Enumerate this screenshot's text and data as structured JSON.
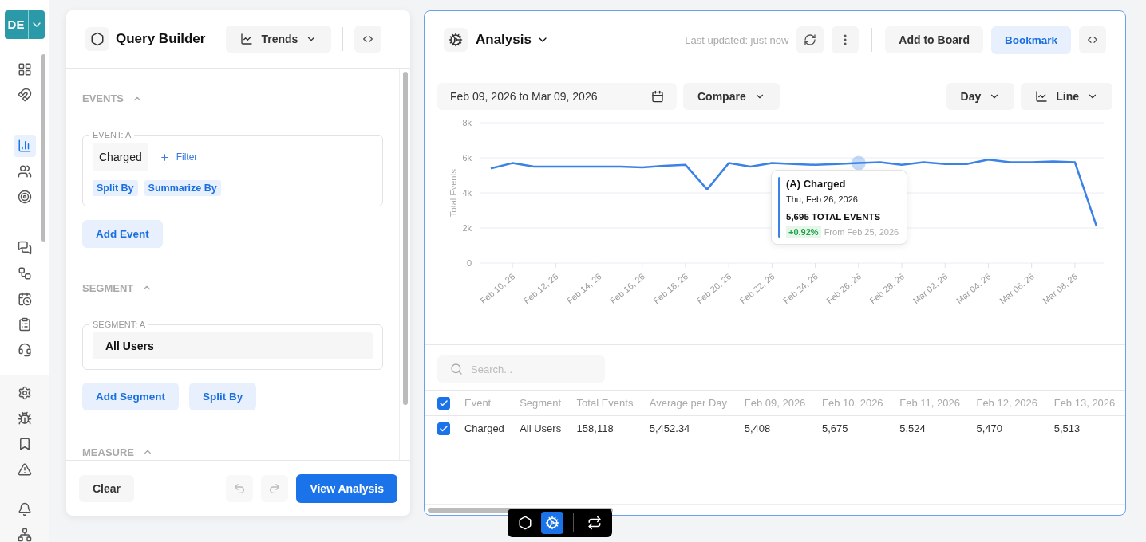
{
  "workspace": {
    "badge": "DE"
  },
  "nav": {
    "items": [
      {
        "selected": false
      },
      {
        "selected": false
      },
      {
        "selected": true
      },
      {
        "selected": false
      },
      {
        "selected": false
      },
      {
        "selected": false
      },
      {
        "selected": false
      },
      {
        "selected": false
      },
      {
        "selected": false
      },
      {
        "selected": false
      }
    ],
    "bottom_items": [
      {
        "selected": false
      },
      {
        "selected": false
      },
      {
        "selected": false
      },
      {
        "selected": false
      },
      {
        "selected": false
      },
      {
        "selected": false
      }
    ]
  },
  "query_builder": {
    "title": "Query Builder",
    "mode": "Trends",
    "events": {
      "heading": "EVENTS",
      "expanded": true,
      "legend": "EVENT: A",
      "event": "Charged",
      "filter": "Filter",
      "chips": [
        "Split By",
        "Summarize By"
      ],
      "add": "Add Event"
    },
    "segment": {
      "heading": "SEGMENT",
      "expanded": true,
      "legend": "SEGMENT: A",
      "value": "All Users",
      "buttons": [
        "Add Segment",
        "Split By"
      ]
    },
    "measure": {
      "heading": "MEASURE",
      "expanded": true
    },
    "footer": {
      "clear": "Clear",
      "undo_disabled": true,
      "redo_disabled": true,
      "submit": "View Analysis"
    }
  },
  "analysis": {
    "title": "Analysis",
    "last_updated": "Last updated: just now",
    "add_to_board": "Add to Board",
    "bookmark": "Bookmark",
    "date_range": "Feb 09, 2026 to Mar 09, 2026",
    "compare": "Compare",
    "interval": "Day",
    "chart_type": "Line",
    "chart": {
      "chart_data": {
        "type": "line",
        "grid": true,
        "ylabel": "Total Events",
        "ylim": [
          0,
          8000
        ],
        "yticks": [
          {
            "value": 0,
            "label": "0"
          },
          {
            "value": 2000,
            "label": "2k"
          },
          {
            "value": 4000,
            "label": "4k"
          },
          {
            "value": 6000,
            "label": "6k"
          },
          {
            "value": 8000,
            "label": "8k"
          }
        ],
        "categories": [
          null,
          "Feb 10, 26",
          null,
          "Feb 12, 26",
          null,
          "Feb 14, 26",
          null,
          "Feb 16, 26",
          null,
          "Feb 18, 26",
          null,
          "Feb 20, 26",
          null,
          "Feb 22, 26",
          null,
          "Feb 24, 26",
          null,
          "Feb 26, 26",
          null,
          "Feb 28, 26",
          null,
          "Mar 02, 26",
          null,
          "Mar 04, 26",
          null,
          "Mar 06, 26",
          null,
          "Mar 08, 26",
          null
        ],
        "series": [
          {
            "name": "(A) Charged",
            "color": "#3b82e8",
            "values": [
              5400,
              5700,
              5500,
              5500,
              5500,
              5500,
              5500,
              5450,
              5550,
              5600,
              4200,
              5700,
              5500,
              5700,
              5650,
              5600,
              5650,
              5700,
              5750,
              5600,
              5750,
              5650,
              5650,
              5900,
              5750,
              5750,
              5800,
              5750,
              2100
            ]
          }
        ]
      },
      "tooltip": {
        "date": "Thu, Feb 26, 2026",
        "total": "5,695 TOTAL EVENTS",
        "change": "+0.92%",
        "from": "From Feb 25, 2026"
      }
    },
    "table": {
      "search_placeholder": "Search...",
      "header_checked": true,
      "columns": [
        "Event",
        "Segment",
        "Total Events",
        "Average per Day",
        "Feb 09, 2026",
        "Feb 10, 2026",
        "Feb 11, 2026",
        "Feb 12, 2026",
        "Feb 13, 2026"
      ],
      "rows": [
        {
          "checked": true,
          "cells": [
            "Charged",
            "All Users",
            "158,118",
            "5,452.34",
            "5,408",
            "5,675",
            "5,524",
            "5,470",
            "5,513"
          ]
        }
      ]
    }
  },
  "dock": {
    "items": [
      {
        "selected": false
      },
      {
        "selected": true
      },
      {
        "selected": false
      }
    ]
  }
}
